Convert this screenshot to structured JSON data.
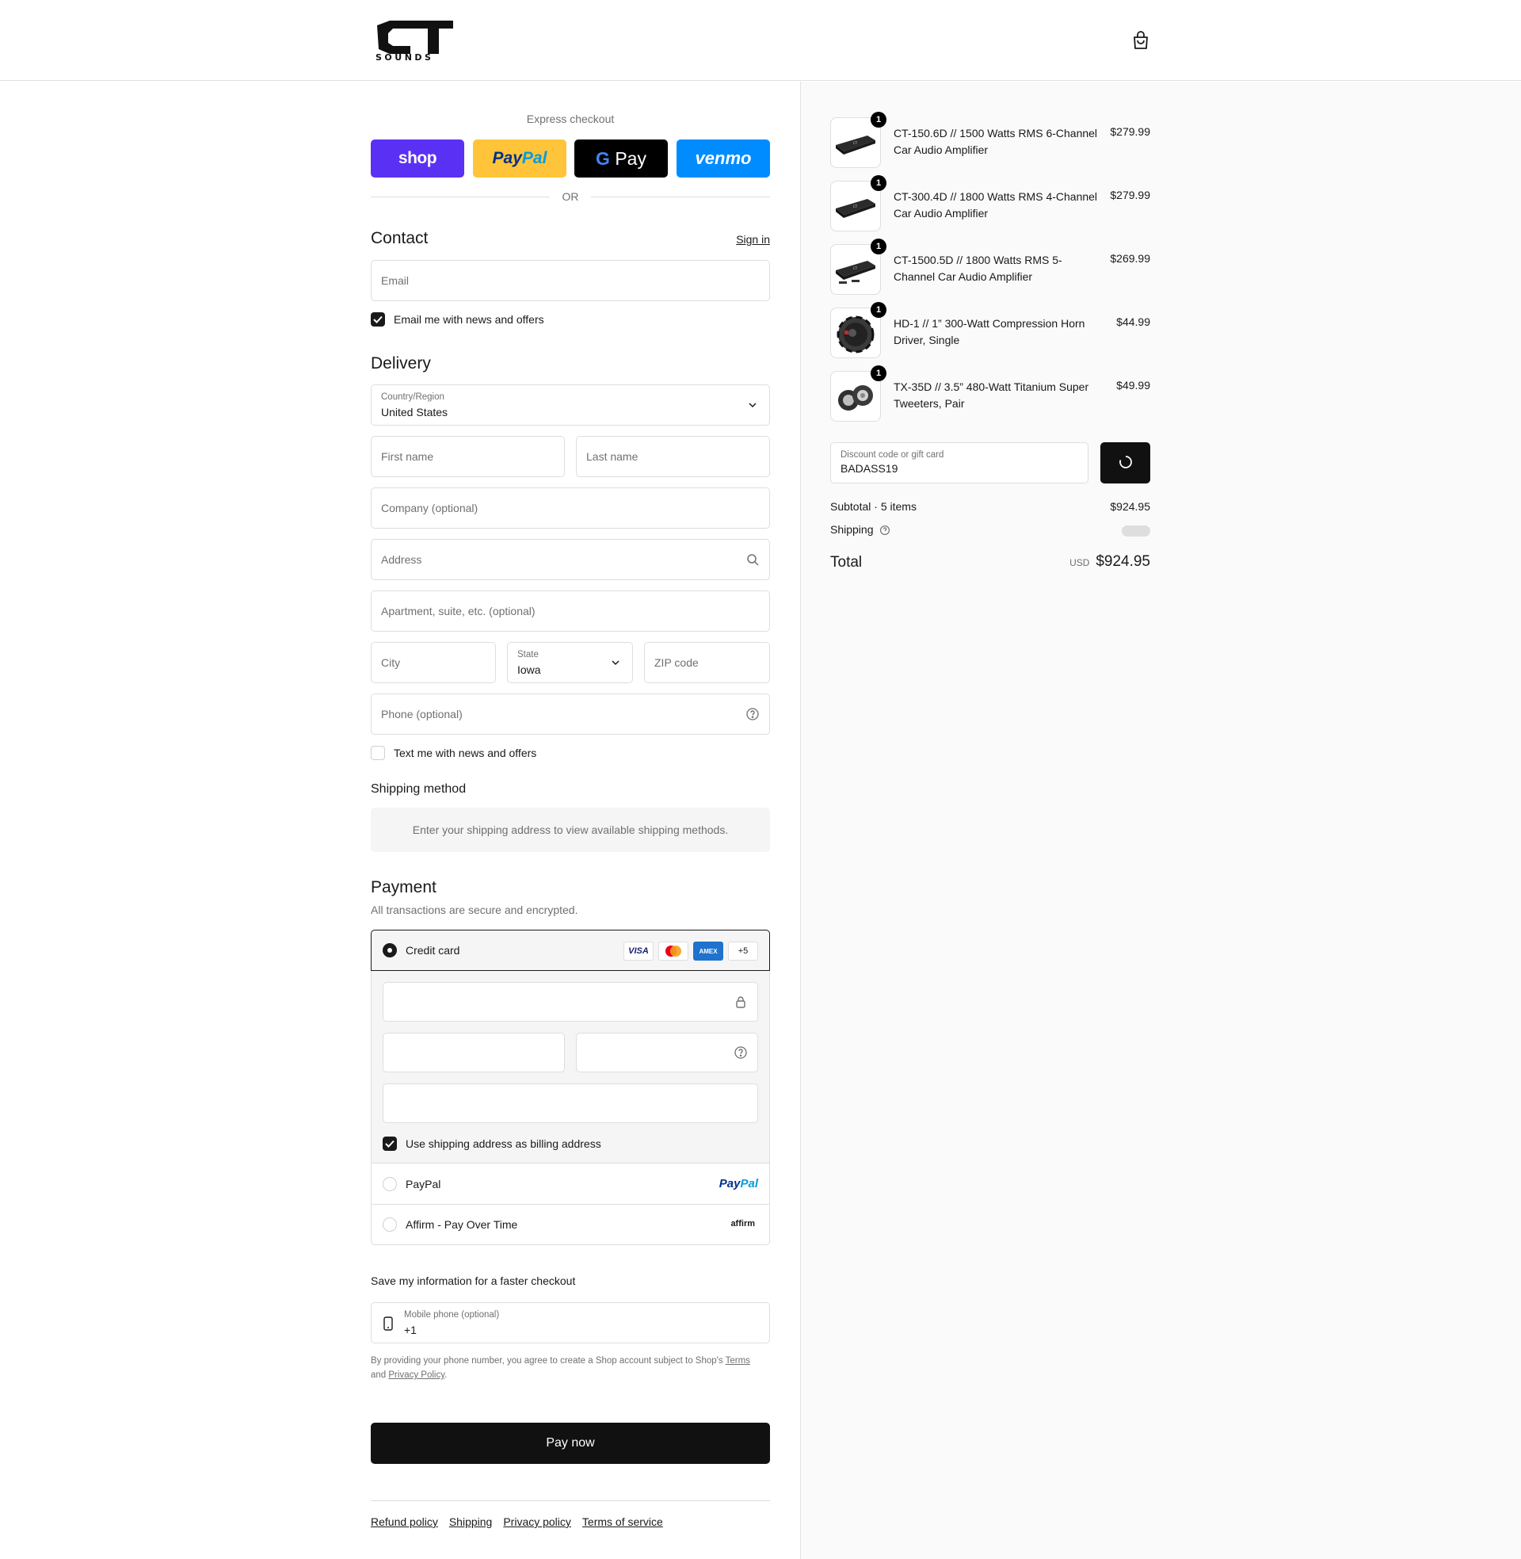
{
  "brand": {
    "logo_top": "CT",
    "logo_bottom": "SOUNDS"
  },
  "express": {
    "title": "Express checkout",
    "shop_label": "shop",
    "paypal_part1": "Pay",
    "paypal_part2": "Pal",
    "gpay_g": "G",
    "gpay_label": "Pay",
    "venmo_label": "venmo",
    "or_label": "OR"
  },
  "contact": {
    "heading": "Contact",
    "sign_in": "Sign in",
    "email_placeholder": "Email",
    "news_opt_in": "Email me with news and offers",
    "news_checked": true
  },
  "delivery": {
    "heading": "Delivery",
    "country_label": "Country/Region",
    "country_value": "United States",
    "first_name": "First name",
    "last_name": "Last name",
    "company": "Company (optional)",
    "address": "Address",
    "apartment": "Apartment, suite, etc. (optional)",
    "city": "City",
    "state_label": "State",
    "state_value": "Iowa",
    "zip": "ZIP code",
    "phone": "Phone (optional)",
    "text_opt_in": "Text me with news and offers",
    "text_checked": false
  },
  "shipping_method": {
    "heading": "Shipping method",
    "notice": "Enter your shipping address to view available shipping methods."
  },
  "payment": {
    "heading": "Payment",
    "subtitle": "All transactions are secure and encrypted.",
    "credit_card_label": "Credit card",
    "card_logos": [
      "VISA",
      "MC",
      "AMEX",
      "+5"
    ],
    "billing_same": "Use shipping address as billing address",
    "billing_checked": true,
    "paypal_label": "PayPal",
    "paypal_logo_1": "Pay",
    "paypal_logo_2": "Pal",
    "affirm_label": "Affirm - Pay Over Time",
    "affirm_logo": "affirm"
  },
  "save_info": {
    "heading": "Save my information for a faster checkout",
    "mobile_label": "Mobile phone (optional)",
    "mobile_value": "+1",
    "legal_prefix": "By providing your phone number, you agree to create a Shop account subject to Shop's",
    "terms": "Terms",
    "and": "and",
    "privacy": "Privacy Policy",
    "period": "."
  },
  "pay_now": "Pay now",
  "footer_links": [
    "Refund policy",
    "Shipping",
    "Privacy policy",
    "Terms of service"
  ],
  "cart": {
    "items": [
      {
        "qty": "1",
        "name": "CT-150.6D // 1500 Watts RMS 6-Channel Car Audio Amplifier",
        "price": "$279.99"
      },
      {
        "qty": "1",
        "name": "CT-300.4D // 1800 Watts RMS 4-Channel Car Audio Amplifier",
        "price": "$279.99"
      },
      {
        "qty": "1",
        "name": "CT-1500.5D // 1800 Watts RMS 5-Channel Car Audio Amplifier",
        "price": "$269.99"
      },
      {
        "qty": "1",
        "name": "HD-1 // 1” 300-Watt Compression Horn Driver, Single",
        "price": "$44.99"
      },
      {
        "qty": "1",
        "name": "TX-35D // 3.5” 480-Watt Titanium Super Tweeters, Pair",
        "price": "$49.99"
      }
    ],
    "discount_label": "Discount code or gift card",
    "discount_value": "BADASS19",
    "subtotal_label": "Subtotal · 5 items",
    "subtotal_value": "$924.95",
    "shipping_label": "Shipping",
    "total_label": "Total",
    "currency": "USD",
    "total_value": "$924.95"
  }
}
